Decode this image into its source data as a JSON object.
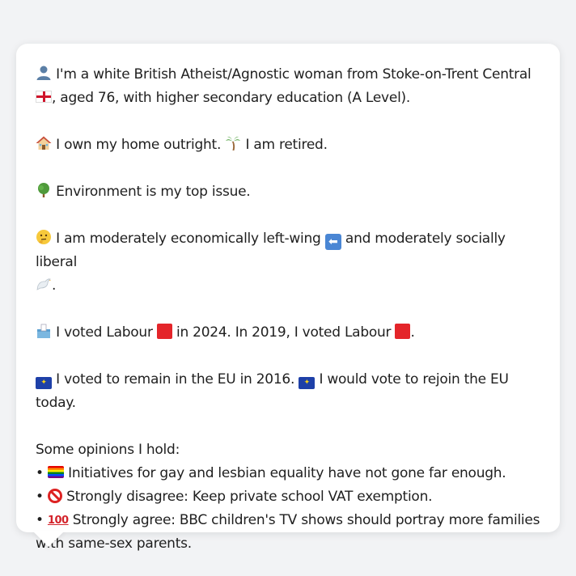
{
  "card": {
    "p1": {
      "icon": "person-icon",
      "text_a": "I'm a white British Atheist/Agnostic woman from Stoke-on-Trent Central",
      "flag": "england-flag-icon",
      "text_b": ", aged 76, with higher secondary education (A Level)."
    },
    "p2": {
      "icon_home": "house-icon",
      "text_a": "I own my home outright.",
      "icon_palm": "palm-tree-icon",
      "text_b": "I am retired."
    },
    "p3": {
      "icon": "tree-icon",
      "text": "Environment is my top issue."
    },
    "p4": {
      "icon_think": "thinking-face-icon",
      "text_a": "I am moderately economically left-wing",
      "icon_arrow": "left-arrow-icon",
      "text_b": "and moderately socially liberal",
      "icon_dove": "dove-icon",
      "text_c": "."
    },
    "p5": {
      "icon_ballot": "ballot-box-icon",
      "text_a": "I voted Labour",
      "text_b": "in 2024. In 2019, I voted Labour",
      "text_c": ".",
      "labour_color": "#e4252a"
    },
    "p6": {
      "text_a": "I voted to remain in the EU in 2016.",
      "text_b": "I would vote to rejoin the EU today.",
      "eu_color": "#1e40a8"
    },
    "opinions": {
      "heading": "Some opinions I hold:",
      "items": [
        {
          "icon": "rainbow-flag-icon",
          "text": "Initiatives for gay and lesbian equality have not gone far enough."
        },
        {
          "icon": "no-entry-icon",
          "text": "Strongly disagree: Keep private school VAT exemption."
        },
        {
          "icon": "hundred-points-icon",
          "text": "Strongly agree: BBC children's TV shows should portray more families with same-sex parents."
        }
      ]
    }
  }
}
